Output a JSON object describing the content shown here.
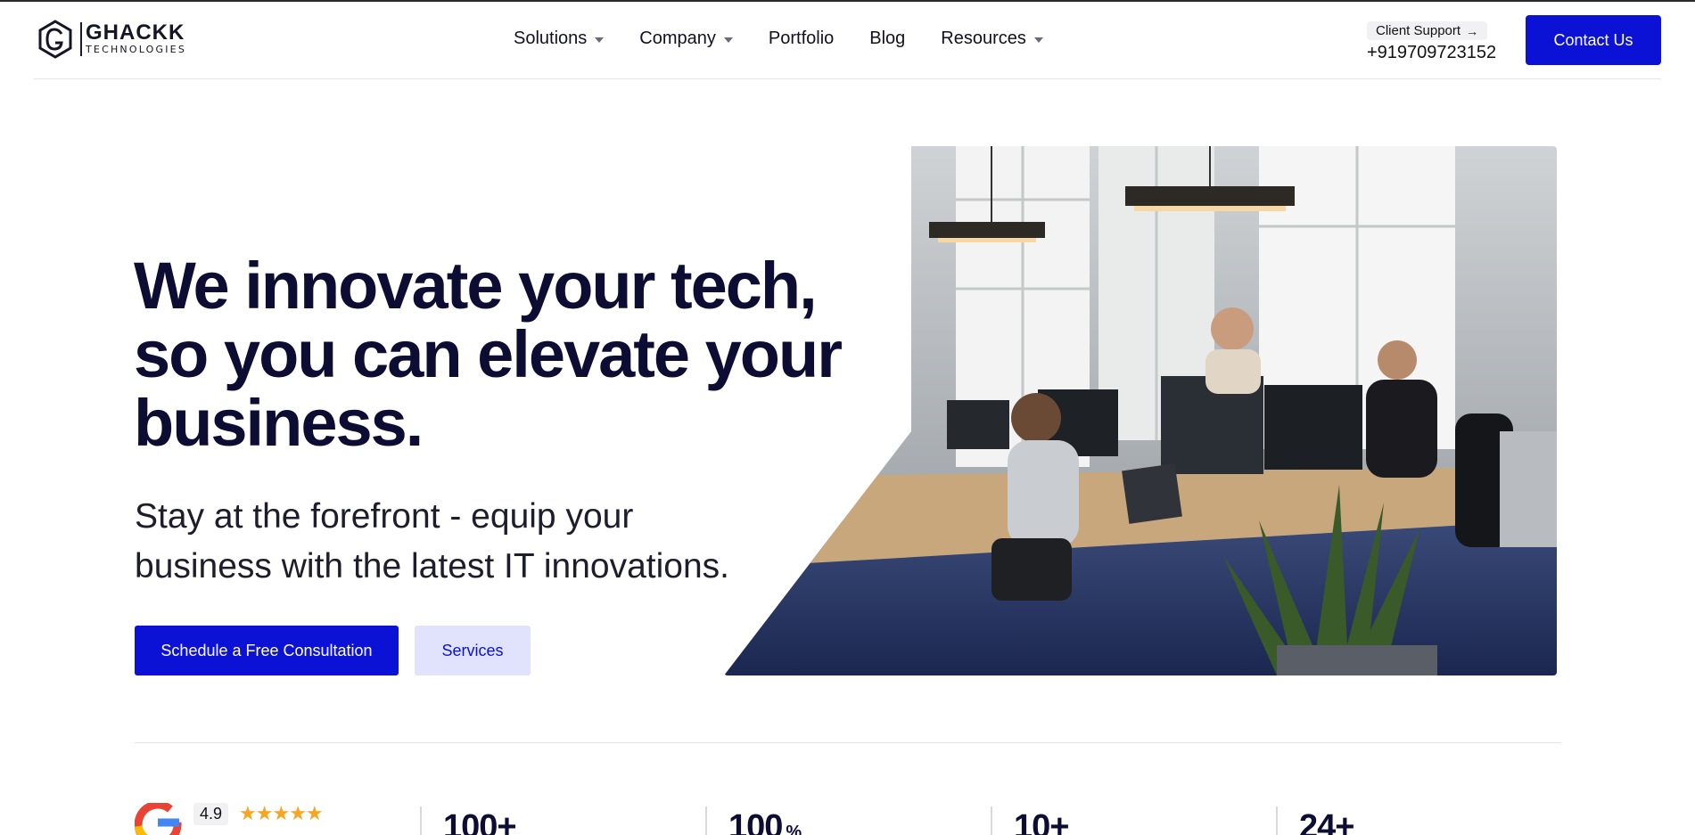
{
  "brand": {
    "name": "GHACKK",
    "tagline": "TECHNOLOGIES"
  },
  "nav": {
    "items": [
      {
        "label": "Solutions",
        "dropdown": true
      },
      {
        "label": "Company",
        "dropdown": true
      },
      {
        "label": "Portfolio",
        "dropdown": false
      },
      {
        "label": "Blog",
        "dropdown": false
      },
      {
        "label": "Resources",
        "dropdown": true
      }
    ]
  },
  "support": {
    "label": "Client Support",
    "arrow": "→",
    "phone": "+919709723152"
  },
  "header": {
    "contact_label": "Contact Us"
  },
  "hero": {
    "title_line1": "We innovate your tech,",
    "title_line2": "so you can elevate your",
    "title_line3": "business.",
    "subtitle_line1": "Stay at the forefront - equip your",
    "subtitle_line2": "business with the latest IT innovations.",
    "primary_cta": "Schedule a Free Consultation",
    "secondary_cta": "Services"
  },
  "stats": {
    "rating": {
      "score": "4.9",
      "stars": "★★★★★",
      "rating_value": 4.5
    },
    "items": [
      {
        "value": "100+",
        "unit": ""
      },
      {
        "value": "100",
        "unit": "%"
      },
      {
        "value": "10+",
        "unit": ""
      },
      {
        "value": "24+",
        "unit": ""
      }
    ]
  },
  "colors": {
    "brand_blue": "#0b12d6",
    "light_blue": "#e1e2fb",
    "heading": "#0d0d33",
    "star": "#f5a623"
  }
}
